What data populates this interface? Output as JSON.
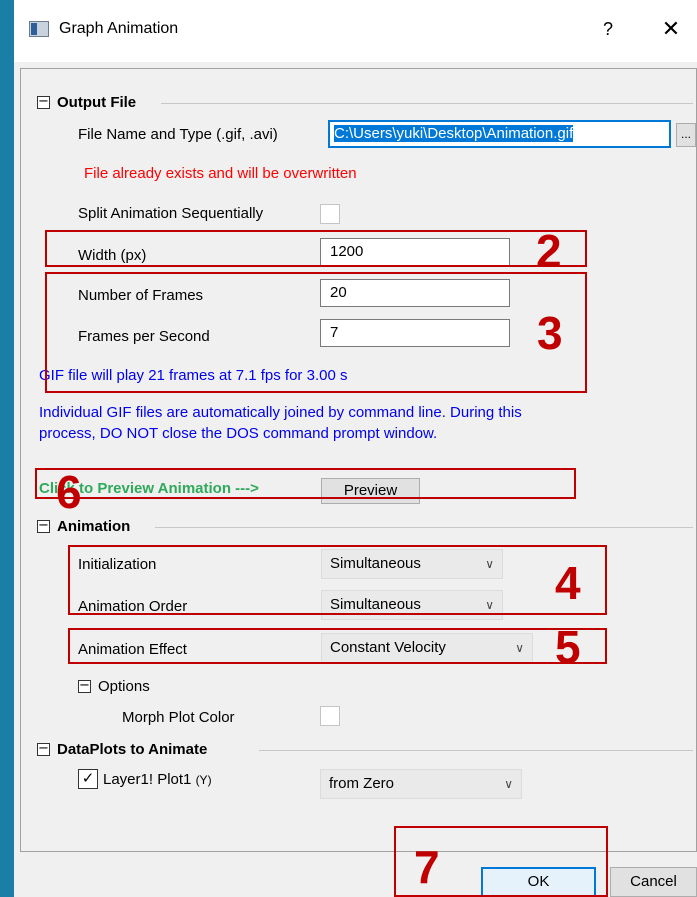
{
  "window": {
    "title": "Graph Animation",
    "help_label": "?",
    "close_label": "✕"
  },
  "output_file": {
    "toggle": "−",
    "title": "Output File",
    "file_label": "File Name and Type (.gif, .avi)",
    "file_value": "C:\\Users\\yuki\\Desktop\\Animation.gif",
    "browse_label": "...",
    "warning": "File already exists and will be overwritten",
    "split_label": "Split Animation Sequentially",
    "width_label": "Width (px)",
    "width_value": "1200",
    "frames_label": "Number of Frames",
    "frames_value": "20",
    "fps_label": "Frames per Second",
    "fps_value": "7",
    "gif_info": "GIF file will play 21 frames at 7.1 fps for 3.00 s",
    "join_info_line1": "Individual GIF files are automatically joined by command line. During this",
    "join_info_line2": "process, DO NOT close the DOS command prompt window.",
    "preview_hint": "Click to Preview Animation   --->",
    "preview_button": "Preview"
  },
  "animation": {
    "toggle": "−",
    "title": "Animation",
    "init_label": "Initialization",
    "init_value": "Simultaneous",
    "order_label": "Animation Order",
    "order_value": "Simultaneous",
    "effect_label": "Animation Effect",
    "effect_value": "Constant Velocity",
    "options_toggle": "−",
    "options_title": "Options",
    "morph_label": "Morph Plot Color"
  },
  "dataplots": {
    "toggle": "−",
    "title": "DataPlots to Animate",
    "check": "✓",
    "plot_label": "Layer1! Plot1",
    "plot_suffix": "(Y)",
    "plot_value": "from  Zero"
  },
  "buttons": {
    "ok": "OK",
    "cancel": "Cancel"
  },
  "annotations": {
    "n2": "2",
    "n3": "3",
    "n4": "4",
    "n5": "5",
    "n6": "6",
    "n7": "7"
  },
  "icons": {
    "chevron": "∨"
  },
  "colors": {
    "accent": "#0078d7",
    "annotation": "#c00000",
    "warning": "#ff0000",
    "info": "#0000ee",
    "hint": "#2eaa5a",
    "desktop": "#1b7ea6"
  }
}
